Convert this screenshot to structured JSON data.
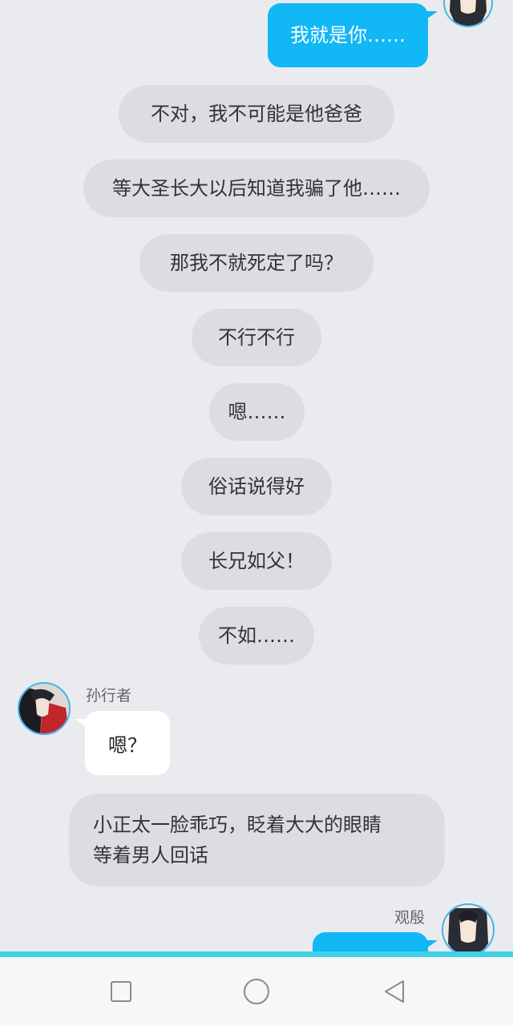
{
  "chat": {
    "top_outgoing": {
      "text": "我就是你……"
    },
    "narrations": [
      "不对，我不可能是他爸爸",
      "等大圣长大以后知道我骗了他……",
      "那我不就死定了吗？",
      "不行不行",
      "嗯……",
      "俗话说得好",
      "长兄如父！",
      "不如……"
    ],
    "incoming": {
      "sender": "孙行者",
      "text": "嗯？"
    },
    "long_narration": {
      "line1": "小正太一脸乖巧，眨着大大的眼睛",
      "line2": "等着男人回话"
    },
    "bottom_outgoing": {
      "sender": "观殷",
      "text": ""
    }
  },
  "navbar": {
    "buttons": [
      {
        "icon": "square-icon",
        "role": "recent-apps"
      },
      {
        "icon": "circle-icon",
        "role": "home"
      },
      {
        "icon": "triangle-back-icon",
        "role": "back"
      }
    ]
  },
  "colors": {
    "background": "#eaebef",
    "outgoing_bubble": "#12b7f5",
    "narration_bubble": "#dcdde3",
    "incoming_bubble": "#ffffff",
    "accent_line": "#41d1e8"
  }
}
